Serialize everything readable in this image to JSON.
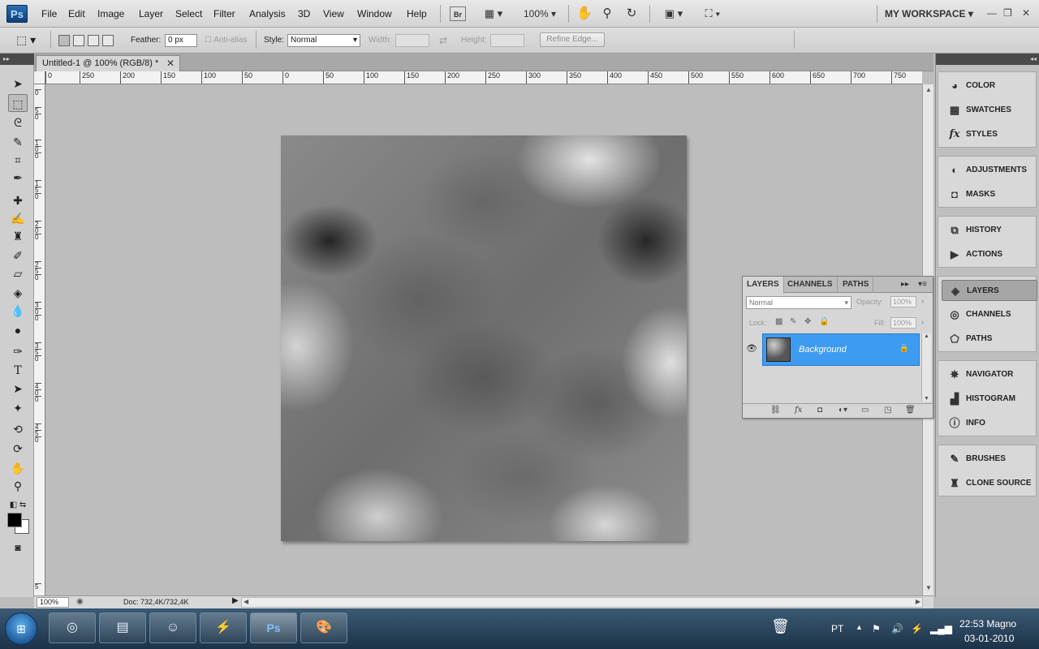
{
  "app": {
    "logo": "Ps",
    "menu": [
      "File",
      "Edit",
      "Image",
      "Layer",
      "Select",
      "Filter",
      "Analysis",
      "3D",
      "View",
      "Window",
      "Help"
    ],
    "bridge_label": "Br",
    "zoom_menu": "100%",
    "workspace": "MY WORKSPACE"
  },
  "options": {
    "feather_label": "Feather:",
    "feather_value": "0 px",
    "antialias_label": "Anti-alias",
    "style_label": "Style:",
    "style_value": "Normal",
    "width_label": "Width:",
    "height_label": "Height:",
    "refine_edge": "Refine Edge..."
  },
  "document": {
    "tab_title": "Untitled-1 @ 100% (RGB/8) *",
    "zoom": "100%",
    "doc_info": "Doc: 732,4K/732,4K"
  },
  "ruler": {
    "top_labels": [
      "0",
      "250",
      "200",
      "150",
      "100",
      "50",
      "0",
      "50",
      "100",
      "150",
      "200",
      "250",
      "300",
      "350",
      "400",
      "450",
      "500",
      "550",
      "600",
      "650",
      "700",
      "750"
    ],
    "left_labels": [
      "0",
      "5",
      "0",
      "1",
      "0",
      "0",
      "1",
      "5",
      "0",
      "2",
      "0",
      "0",
      "2",
      "5",
      "0",
      "3",
      "0",
      "0",
      "3",
      "5",
      "0",
      "4",
      "0",
      "0",
      "4",
      "5",
      "0",
      "5"
    ]
  },
  "dock": {
    "groups": [
      [
        "COLOR",
        "SWATCHES",
        "STYLES"
      ],
      [
        "ADJUSTMENTS",
        "MASKS"
      ],
      [
        "HISTORY",
        "ACTIONS"
      ],
      [
        "LAYERS",
        "CHANNELS",
        "PATHS"
      ],
      [
        "NAVIGATOR",
        "HISTOGRAM",
        "INFO"
      ],
      [
        "BRUSHES",
        "CLONE SOURCE"
      ]
    ]
  },
  "layers_panel": {
    "tabs": [
      "LAYERS",
      "CHANNELS",
      "PATHS"
    ],
    "blend_mode": "Normal",
    "opacity_label": "Opacity:",
    "opacity_value": "100%",
    "lock_label": "Lock:",
    "fill_label": "Fill:",
    "fill_value": "100%",
    "layer_name": "Background"
  },
  "taskbar": {
    "language": "PT",
    "time": "22:53 Magno",
    "date": "03-01-2010"
  }
}
